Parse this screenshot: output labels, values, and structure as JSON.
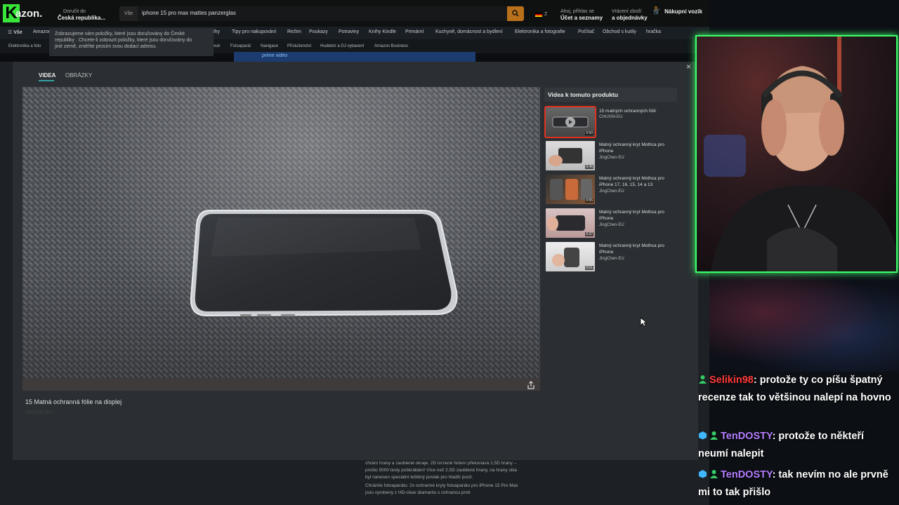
{
  "amazon": {
    "logo_text": "azon.",
    "deliver_label": "Doručit do",
    "deliver_location": "Česká republika...",
    "search_category": "Vše",
    "search_query": "iphone 15 pro max mattes panzerglas",
    "lang": "Z",
    "account_greeting": "Ahoj, přihlas se",
    "account_label": "Účet a seznamy",
    "returns_label": "Vrácení zboží",
    "orders_label": "a objednávky",
    "cart_count": "0",
    "cart_label": "Nákupní vozík",
    "menu_all": "Vše",
    "nav": [
      "Amazon",
      "ihy",
      "Tipy pro nakupování",
      "Režim",
      "Poukazy",
      "Potraviny",
      "Knihy Kindle",
      "Primární",
      "Kuchyně, domácnost a bydlení",
      "Elektronika a fotografie",
      "Počítač",
      "Obchod s kutily",
      "hračka"
    ],
    "subnav": [
      "Elektronika a foto",
      "vzvuk",
      "Fotoaparát",
      "Navigace",
      "Příslušenství",
      "Hudební a DJ vybavení",
      "Amazon Business"
    ],
    "banner_text": "prime video",
    "popup_line1": "Zobrazujeme vám položky, které jsou doručovány do České",
    "popup_line2": "republiky . Chcete-li zobrazit položky, které jsou doručovány do",
    "popup_line3": "jiné země, změňte prosím svou dodací adresu."
  },
  "modal": {
    "tab_videos": "VIDEA",
    "tab_images": "OBRÁZKY",
    "close": "×",
    "video_title": "15 Matná ochranná fólie na displej",
    "video_sub": "CHUXIN-EU",
    "sidebar_title": "Videa k tomuto produktu",
    "videos": [
      {
        "title": "15 matných ochranných fólií",
        "author": "CHUXIN-EU",
        "duration": "0:50"
      },
      {
        "title": "Matný ochranný kryt Mothca pro iPhone",
        "author": "JingChen-EU",
        "duration": "0:46"
      },
      {
        "title": "Matný ochranný kryt Mothca pro iPhone 17, 16, 15, 14 a 13",
        "author": "JingChen-EU",
        "duration": "0:55"
      },
      {
        "title": "Matný ochranný kryt Mothca pro iPhone",
        "author": "JingChen-EU",
        "duration": "0:37"
      },
      {
        "title": "Matný ochranný kryt Mothca pro iPhone",
        "author": "JingChen-EU",
        "duration": "0:51"
      }
    ]
  },
  "below": {
    "line1": "chrání hrany a zaoblené okraje. 2D tvrzené řešení překonává 2,5D hrany – prošlo 5000 testy poškrábání! Více než 2,5D zaoblené hrany, na hrany skla byl nanesen speciální leštěný povlak pro hladší pocit.",
    "line2": "Chráníte fotoaparátu: 2x ochranné kryty fotoaparátu pro iPhone 15 Pro Max jsou vyrobeny z HD-clear diamantu s ochranou proti"
  },
  "chat": [
    {
      "user": "Selikin98",
      "text": ": protože ty co píšu špatný recenze tak to většinou nalepí na hovno"
    },
    {
      "user": "TenDOSTY",
      "text": ": protože to někteří neumí nalepit"
    },
    {
      "user": "TenDOSTY",
      "text": ": tak nevím no ale prvně mi to tak přišlo"
    }
  ],
  "colors": {
    "webcam_border": "#3cff6a",
    "user1": "#ff3b3b",
    "user2": "#b47eff",
    "accent": "#35a1a1"
  }
}
